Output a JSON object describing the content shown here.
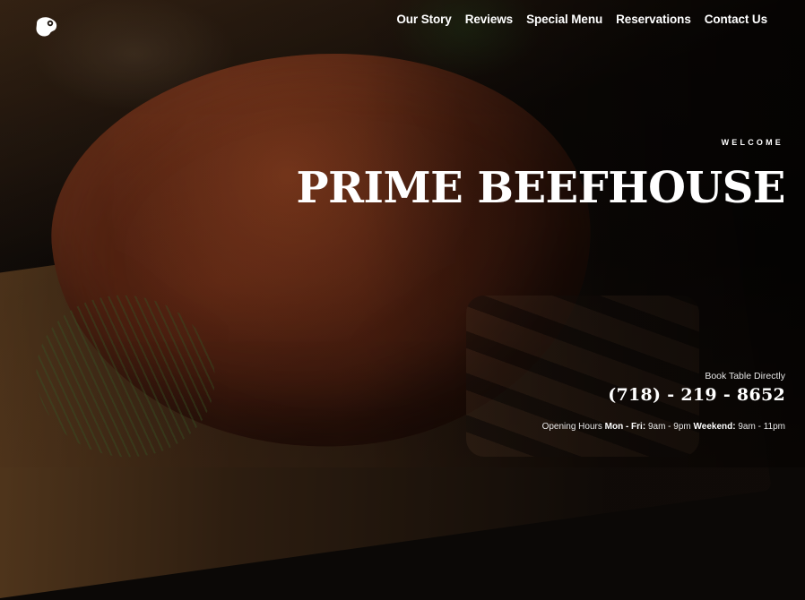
{
  "brand": {
    "logo_icon": "steak-icon"
  },
  "nav": {
    "items": [
      {
        "label": "Our Story"
      },
      {
        "label": "Reviews"
      },
      {
        "label": "Special Menu"
      },
      {
        "label": "Reservations"
      },
      {
        "label": "Contact Us"
      }
    ]
  },
  "hero": {
    "eyebrow": "WELCOME",
    "title": "PRIME BEEFHOUSE",
    "booking_label": "Book Table Directly",
    "phone": "(718) - 219 - 8652",
    "hours": {
      "label": "Opening Hours",
      "weekday_label": "Mon - Fri:",
      "weekday_hours": "9am - 9pm",
      "weekend_label": "Weekend:",
      "weekend_hours": "9am - 11pm"
    }
  }
}
